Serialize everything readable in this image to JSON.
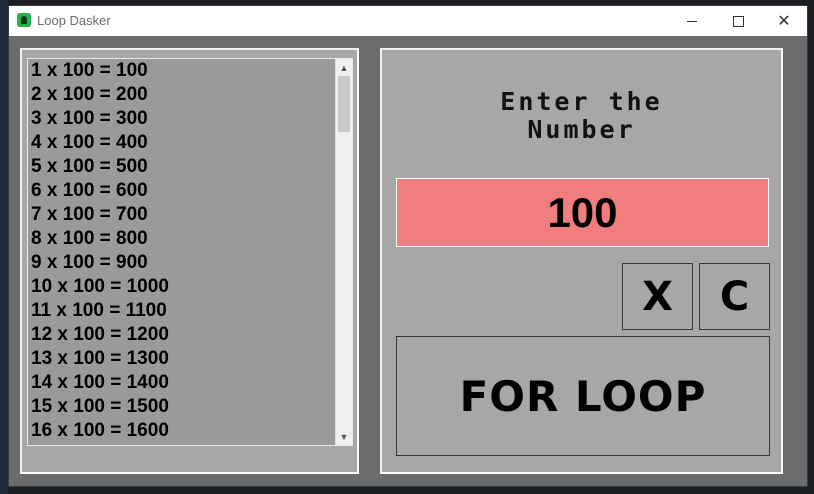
{
  "window": {
    "title": "Loop Dasker"
  },
  "title_buttons": {
    "minimize": "minimize",
    "maximize": "maximize",
    "close": "close"
  },
  "results": [
    "1 x 100 = 100",
    "2 x 100 = 200",
    "3 x 100 = 300",
    "4 x 100 = 400",
    "5 x 100 = 500",
    "6 x 100 = 600",
    "7 x 100 = 700",
    "8 x 100 = 800",
    "9 x 100 = 900",
    "10 x 100 = 1000",
    "11 x 100 = 1100",
    "12 x 100 = 1200",
    "13 x 100 = 1300",
    "14 x 100 = 1400",
    "15 x 100 = 1500",
    "16 x 100 = 1600"
  ],
  "input_panel": {
    "prompt_line1": "Enter the",
    "prompt_line2": "Number",
    "number_value": "100",
    "clear_x_label": "X",
    "clear_c_label": "C",
    "for_loop_label": "FOR LOOP"
  },
  "icons": {
    "app": "app-icon",
    "scroll_up": "chevron-up-icon",
    "scroll_down": "chevron-down-icon"
  },
  "colors": {
    "number_box": "#f07e7e",
    "panel_bg": "#a7a7a7",
    "list_bg": "#9a9a9a",
    "window_bg": "#6b6b6b"
  }
}
